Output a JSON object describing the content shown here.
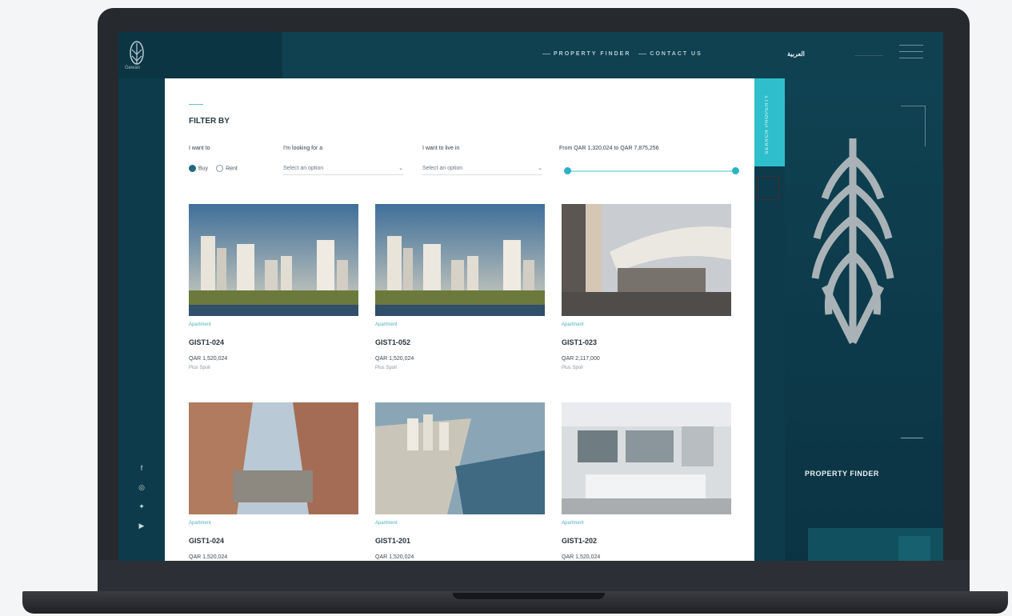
{
  "header": {
    "logo_text": "Gewan",
    "nav": [
      "PROPERTY FINDER",
      "CONTACT US"
    ],
    "lang": "العربية"
  },
  "filter": {
    "title": "FILTER BY",
    "want_label": "I want to",
    "opt_buy": "Buy",
    "opt_rent": "Rent",
    "looking_label": "I'm looking for a",
    "looking_placeholder": "Select an option",
    "live_label": "I want to live in",
    "live_placeholder": "Select an option",
    "price_label": "From QAR 1,320,024 to QAR 7,875,256",
    "price_min_fraction": 0.0,
    "price_max_fraction": 1.0
  },
  "tab": {
    "label": "SEARCH PROPERTY"
  },
  "listings": [
    {
      "type": "Apartment",
      "code": "GIST1-024",
      "price": "QAR 1,520,024",
      "status": "Plus Spoil"
    },
    {
      "type": "Apartment",
      "code": "GIST1-052",
      "price": "QAR 1,520,024",
      "status": "Plus Spoil"
    },
    {
      "type": "Apartment",
      "code": "GIST1-023",
      "price": "QAR 2,117,000",
      "status": "Plus Spoil"
    },
    {
      "type": "Apartment",
      "code": "GIST1-024",
      "price": "QAR 1,520,024",
      "status": ""
    },
    {
      "type": "Apartment",
      "code": "GIST1-201",
      "price": "QAR 1,520,024",
      "status": ""
    },
    {
      "type": "Apartment",
      "code": "GIST1-202",
      "price": "QAR 1,520,024",
      "status": ""
    }
  ],
  "right_panel": {
    "title": "PROPERTY FINDER"
  },
  "social_icons": [
    "facebook-icon",
    "instagram-icon",
    "twitter-icon",
    "youtube-icon"
  ],
  "colors": {
    "accent": "#2fbfcc",
    "dark_teal": "#0d3b4b"
  }
}
